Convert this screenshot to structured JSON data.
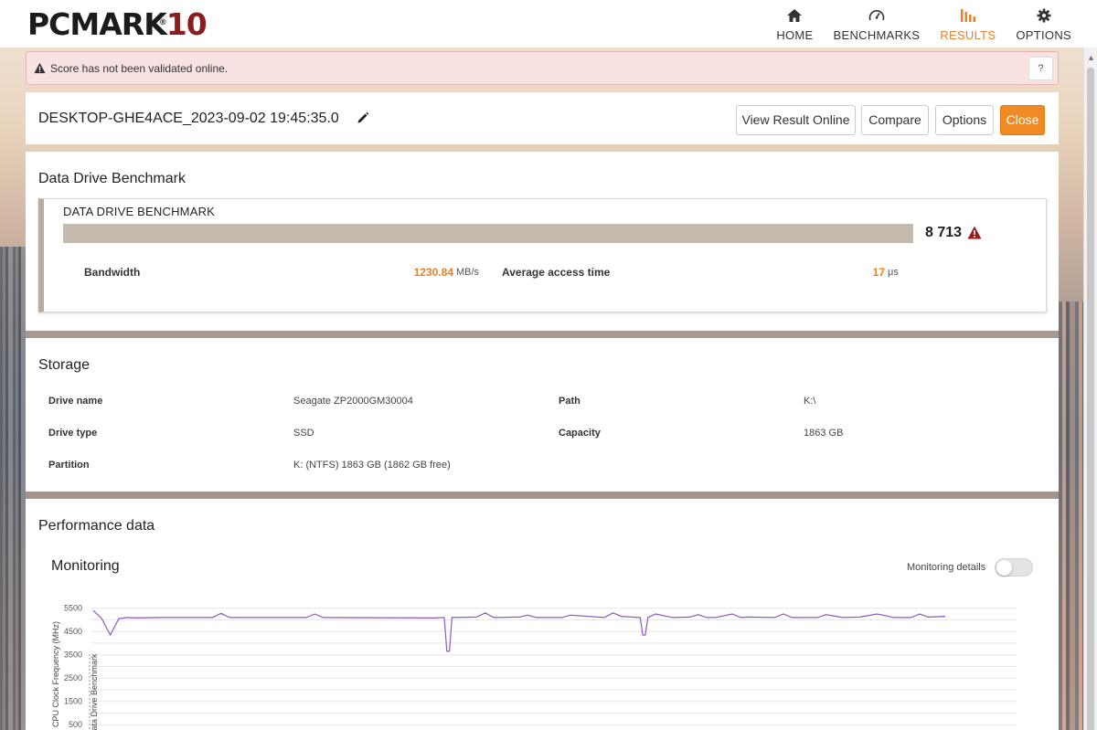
{
  "app": {
    "logo_main": "PCMARK",
    "logo_number": "10",
    "logo_reg": "®"
  },
  "nav": [
    {
      "label": "HOME",
      "icon": "home-icon",
      "active": false
    },
    {
      "label": "BENCHMARKS",
      "icon": "gauge-icon",
      "active": false
    },
    {
      "label": "RESULTS",
      "icon": "bar-chart-icon",
      "active": true
    },
    {
      "label": "OPTIONS",
      "icon": "gear-icon",
      "active": false
    }
  ],
  "colors": {
    "accent": "#e9802a",
    "warning": "#9b1c1c",
    "score_bar": "#c6baad",
    "line": "#8a5bbf"
  },
  "banner": {
    "text": "Score has not been validated online.",
    "help_label": "?"
  },
  "result": {
    "title": "DESKTOP-GHE4ACE_2023-09-02 19:45:35.0",
    "buttons": {
      "view_online": "View Result Online",
      "compare": "Compare",
      "options": "Options",
      "close": "Close"
    }
  },
  "benchmark": {
    "section_title": "Data Drive Benchmark",
    "box_title": "DATA DRIVE BENCHMARK",
    "score": "8 713",
    "bandwidth_label": "Bandwidth",
    "bandwidth_value": "1230.84",
    "bandwidth_unit": "MB/s",
    "access_label": "Average access time",
    "access_value": "17",
    "access_unit": "μs"
  },
  "storage": {
    "section_title": "Storage",
    "drive_name_label": "Drive name",
    "drive_name": "Seagate ZP2000GM30004",
    "path_label": "Path",
    "path": "K:\\",
    "drive_type_label": "Drive type",
    "drive_type": "SSD",
    "capacity_label": "Capacity",
    "capacity": "1863 GB",
    "partition_label": "Partition",
    "partition": "K: (NTFS) 1863 GB (1862 GB free)"
  },
  "performance": {
    "section_title": "Performance data",
    "monitoring_title": "Monitoring",
    "monitoring_details_label": "Monitoring details",
    "monitoring_details_on": false
  },
  "chart_data": {
    "type": "line",
    "ylabel": "CPU Clock Frequency (MHz)",
    "marker_label": "Data Drive Benchmark",
    "y_ticks": [
      5500,
      4500,
      3500,
      2500,
      1500,
      500
    ],
    "ylim": [
      0,
      5800
    ],
    "grid": true,
    "series": [
      {
        "x": [
          0,
          1,
          2,
          3,
          4,
          5,
          8,
          14,
          15,
          16,
          25,
          26,
          27,
          40,
          45,
          46,
          47,
          50,
          51,
          52,
          55,
          56,
          60,
          61,
          62,
          64,
          66,
          68,
          70,
          71,
          72,
          73,
          75,
          76,
          77,
          80,
          81,
          82,
          85,
          86,
          88,
          90,
          92,
          94,
          96,
          97,
          98,
          100
        ],
        "y": [
          5400,
          5050,
          4350,
          5050,
          5100,
          5080,
          5100,
          5100,
          5280,
          5100,
          5100,
          5250,
          5100,
          5080,
          5120,
          5300,
          5100,
          5120,
          5200,
          5100,
          5100,
          5200,
          5100,
          5300,
          5150,
          5100,
          5250,
          5100,
          5120,
          5220,
          5100,
          5100,
          5250,
          5100,
          5120,
          5100,
          5250,
          5100,
          5100,
          5220,
          5100,
          5120,
          5250,
          5100,
          5100,
          5250,
          5120,
          5150
        ]
      }
    ],
    "dips": [
      {
        "x": 41.5,
        "y": 3650
      },
      {
        "x": 64.5,
        "y": 4350
      }
    ]
  }
}
